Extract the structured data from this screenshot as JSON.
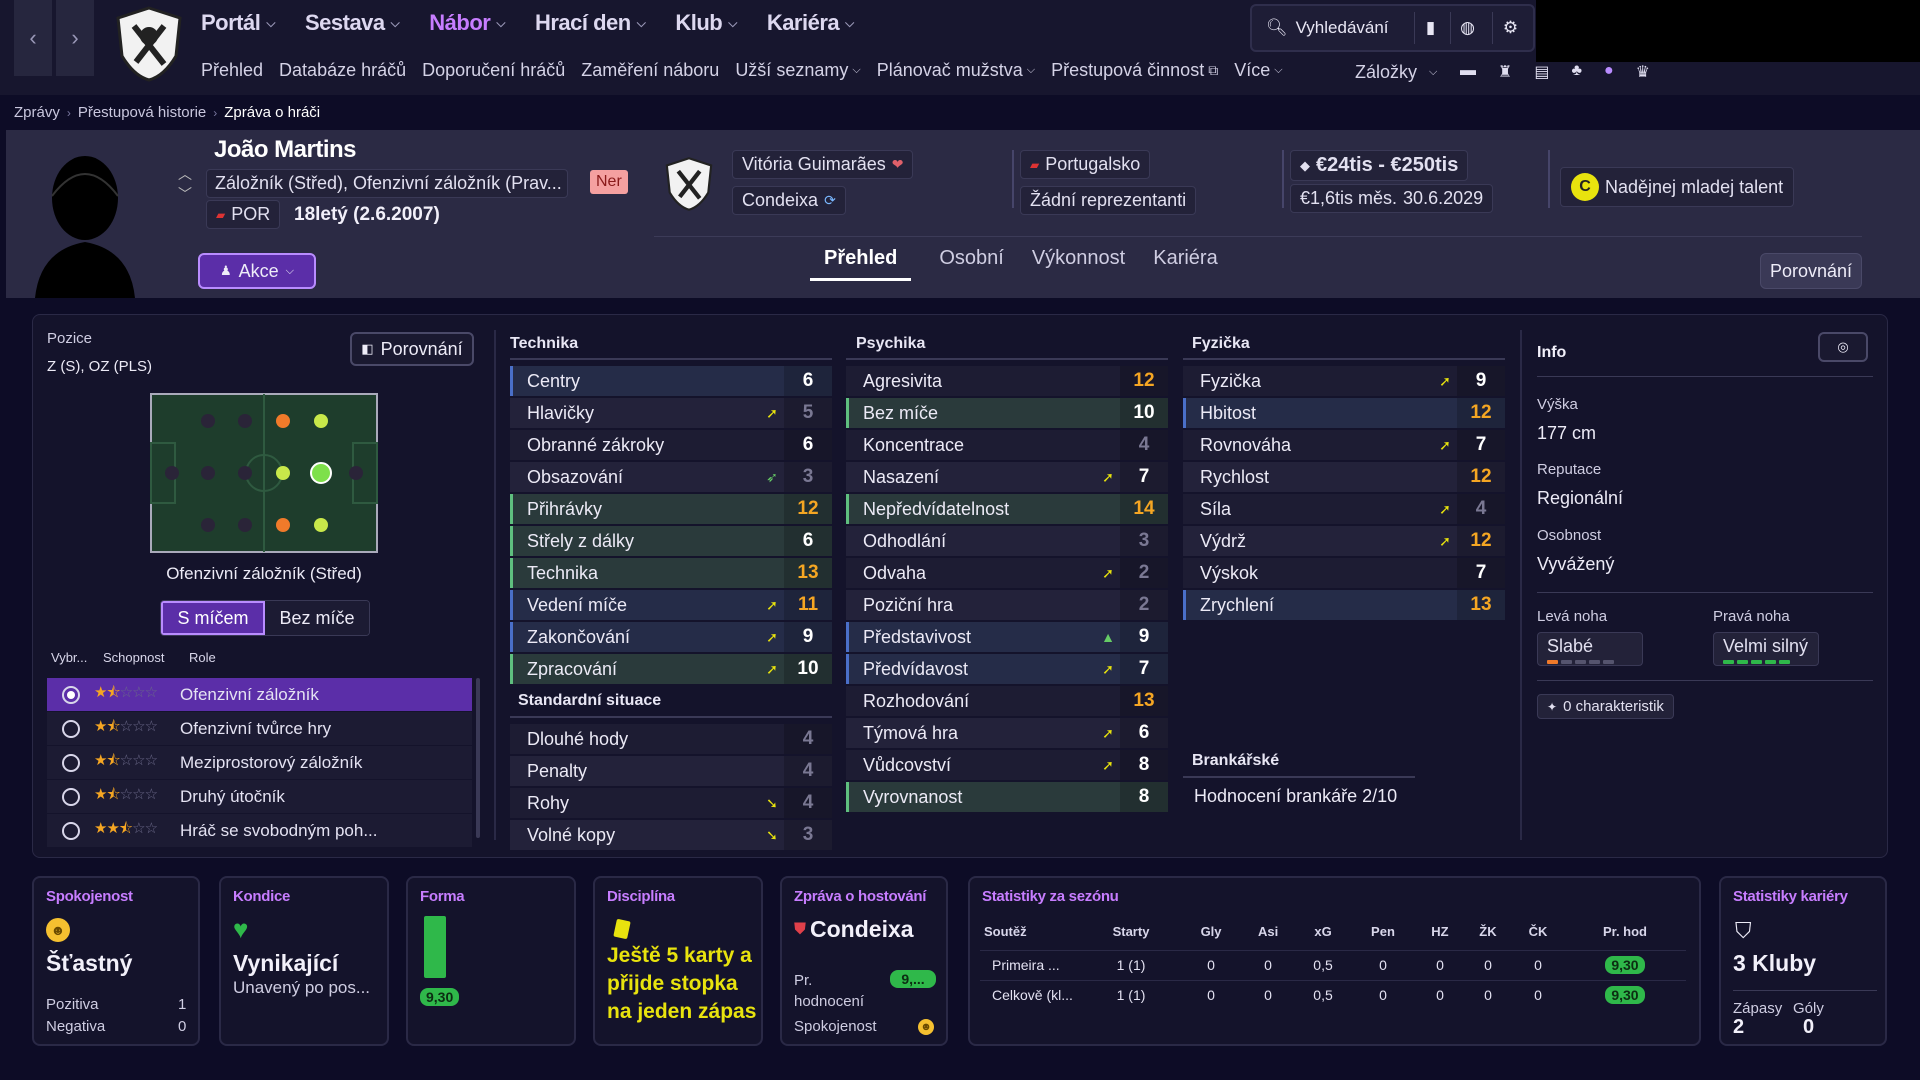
{
  "nav": {
    "main_menu": [
      "Portál",
      "Sestava",
      "Nábor",
      "Hrací den",
      "Klub",
      "Kariéra"
    ],
    "active_menu": "Nábor",
    "sub_menu": [
      "Přehled",
      "Databáze hráčů",
      "Doporučení hráčů",
      "Zaměření náboru",
      "Užší seznamy",
      "Plánovač mužstva",
      "Přestupová činnost",
      "Více"
    ],
    "search_label": "Vyhledávání",
    "bookmarks_label": "Záložky",
    "back_icon": "‹",
    "forward_icon": "›"
  },
  "breadcrumb": [
    "Zprávy",
    "Přestupová historie",
    "Zpráva o hráči"
  ],
  "player": {
    "name": "João Martins",
    "positions": "Záložník (Střed), Ofenzivní záložník (Prav...",
    "nat_code": "POR",
    "age": "18letý (2.6.2007)",
    "badge": "Ner",
    "action_label": "Akce",
    "club": "Vitória Guimarães",
    "loan_club": "Condeixa",
    "nation": "Portugalsko",
    "internationals": "Žádní reprezentanti",
    "value": "€24tis - €250tis",
    "wage": "€1,6tis měs.",
    "contract": "30.6.2029",
    "talent_letter": "C",
    "talent": "Nadějnej mladej talent",
    "compare_label": "Porovnání"
  },
  "tabs": [
    "Přehled",
    "Osobní",
    "Výkonnost",
    "Kariéra"
  ],
  "active_tab": "Přehled",
  "position_panel": {
    "title": "Pozice",
    "positions_short": "Z (S), OZ (PLS)",
    "compare_label": "Porovnání",
    "pitch_role": "Ofenzivní záložník (Střed)",
    "toggle": [
      "S míčem",
      "Bez míče"
    ],
    "role_headers": [
      "Vybr...",
      "Schopnost",
      "Role"
    ],
    "roles": [
      {
        "name": "Ofenzivní záložník",
        "stars": 1.5,
        "selected": true
      },
      {
        "name": "Ofenzivní tvůrce hry",
        "stars": 1.5,
        "selected": false
      },
      {
        "name": "Meziprostorový záložník",
        "stars": 1.5,
        "selected": false
      },
      {
        "name": "Druhý útočník",
        "stars": 1.5,
        "selected": false
      },
      {
        "name": "Hráč se svobodným poh...",
        "stars": 2.5,
        "selected": false
      }
    ]
  },
  "attributes": {
    "technika_title": "Technika",
    "technika": [
      {
        "name": "Centry",
        "value": "6",
        "arrow": "",
        "hl": "blue"
      },
      {
        "name": "Hlavičky",
        "value": "5",
        "arrow": "➚",
        "hl": ""
      },
      {
        "name": "Obranné zákroky",
        "value": "6",
        "arrow": "",
        "hl": ""
      },
      {
        "name": "Obsazování",
        "value": "3",
        "arrow": "➶",
        "hl": ""
      },
      {
        "name": "Přihrávky",
        "value": "12",
        "arrow": "",
        "hl": "green"
      },
      {
        "name": "Střely z dálky",
        "value": "6",
        "arrow": "",
        "hl": "green"
      },
      {
        "name": "Technika",
        "value": "13",
        "arrow": "",
        "hl": "green"
      },
      {
        "name": "Vedení míče",
        "value": "11",
        "arrow": "➚",
        "hl": "blue"
      },
      {
        "name": "Zakončování",
        "value": "9",
        "arrow": "➚",
        "hl": "blue"
      },
      {
        "name": "Zpracování",
        "value": "10",
        "arrow": "➚",
        "hl": "green"
      }
    ],
    "standard_title": "Standardní situace",
    "standard": [
      {
        "name": "Dlouhé hody",
        "value": "4",
        "arrow": "",
        "hl": ""
      },
      {
        "name": "Penalty",
        "value": "4",
        "arrow": "",
        "hl": ""
      },
      {
        "name": "Rohy",
        "value": "4",
        "arrow": "➘",
        "hl": ""
      },
      {
        "name": "Volné kopy",
        "value": "3",
        "arrow": "➘",
        "hl": ""
      }
    ],
    "psychika_title": "Psychika",
    "psychika": [
      {
        "name": "Agresivita",
        "value": "12",
        "arrow": "",
        "hl": ""
      },
      {
        "name": "Bez míče",
        "value": "10",
        "arrow": "",
        "hl": "green"
      },
      {
        "name": "Koncentrace",
        "value": "4",
        "arrow": "",
        "hl": ""
      },
      {
        "name": "Nasazení",
        "value": "7",
        "arrow": "➚",
        "hl": ""
      },
      {
        "name": "Nepředvídatelnost",
        "value": "14",
        "arrow": "",
        "hl": "green"
      },
      {
        "name": "Odhodlání",
        "value": "3",
        "arrow": "",
        "hl": ""
      },
      {
        "name": "Odvaha",
        "value": "2",
        "arrow": "➚",
        "hl": ""
      },
      {
        "name": "Poziční hra",
        "value": "2",
        "arrow": "",
        "hl": ""
      },
      {
        "name": "Představivost",
        "value": "9",
        "arrow": "▲",
        "hl": "blue"
      },
      {
        "name": "Předvídavost",
        "value": "7",
        "arrow": "➚",
        "hl": "blue"
      },
      {
        "name": "Rozhodování",
        "value": "13",
        "arrow": "",
        "hl": ""
      },
      {
        "name": "Týmová hra",
        "value": "6",
        "arrow": "➚",
        "hl": ""
      },
      {
        "name": "Vůdcovství",
        "value": "8",
        "arrow": "➚",
        "hl": ""
      },
      {
        "name": "Vyrovnanost",
        "value": "8",
        "arrow": "",
        "hl": "green"
      }
    ],
    "fyzicka_title": "Fyzička",
    "fyzicka": [
      {
        "name": "Fyzička",
        "value": "9",
        "arrow": "➚",
        "hl": ""
      },
      {
        "name": "Hbitost",
        "value": "12",
        "arrow": "",
        "hl": "blue"
      },
      {
        "name": "Rovnováha",
        "value": "7",
        "arrow": "➚",
        "hl": ""
      },
      {
        "name": "Rychlost",
        "value": "12",
        "arrow": "",
        "hl": ""
      },
      {
        "name": "Síla",
        "value": "4",
        "arrow": "➚",
        "hl": ""
      },
      {
        "name": "Výdrž",
        "value": "12",
        "arrow": "➚",
        "hl": ""
      },
      {
        "name": "Výskok",
        "value": "7",
        "arrow": "",
        "hl": ""
      },
      {
        "name": "Zrychlení",
        "value": "13",
        "arrow": "",
        "hl": "blue"
      }
    ],
    "gk_title": "Brankářské",
    "gk_rating": "Hodnocení brankáře 2/10"
  },
  "info": {
    "title": "Info",
    "height_label": "Výška",
    "height": "177 cm",
    "reputation_label": "Reputace",
    "reputation": "Regionální",
    "personality_label": "Osobnost",
    "personality": "Vyvážený",
    "left_foot_label": "Levá noha",
    "left_foot": "Slabé",
    "right_foot_label": "Pravá noha",
    "right_foot": "Velmi silný",
    "left_foot_level": 0.2,
    "right_foot_level": 1.0,
    "traits": "0 charakteristik"
  },
  "cards": {
    "happiness": {
      "title": "Spokojenost",
      "value": "Šťastný",
      "pos_label": "Pozitiva",
      "pos": "1",
      "neg_label": "Negativa",
      "neg": "0"
    },
    "condition": {
      "title": "Kondice",
      "value": "Vynikající",
      "sub": "Unavený po pos..."
    },
    "form": {
      "title": "Forma",
      "rating": "9,30"
    },
    "discipline": {
      "title": "Disciplína",
      "text": "Ještě 5 karty a přijde stopka na jeden zápas"
    },
    "loan": {
      "title": "Zpráva o hostování",
      "club": "Condeixa",
      "rating_label": "Pr. hodnocení",
      "rating": "9,...",
      "happiness_label": "Spokojenost"
    },
    "season": {
      "title": "Statistiky za sezónu",
      "headers": [
        "Soutěž",
        "Starty",
        "Gly",
        "Asi",
        "xG",
        "Pen",
        "HZ",
        "ŽK",
        "ČK",
        "Pr. hod"
      ],
      "rows": [
        [
          "Primeira ...",
          "1 (1)",
          "0",
          "0",
          "0,5",
          "0",
          "0",
          "0",
          "0",
          "9,30"
        ],
        [
          "Celkově (kl...",
          "1 (1)",
          "0",
          "0",
          "0,5",
          "0",
          "0",
          "0",
          "0",
          "9,30"
        ]
      ]
    },
    "career": {
      "title": "Statistiky kariéry",
      "value": "3 Kluby",
      "apps_label": "Zápasy",
      "goals_label": "Góly",
      "apps": "2",
      "goals": "0"
    }
  },
  "colors": {
    "accent": "#c77dff",
    "active_purple": "#5b2ea8",
    "green": "#2fb84a",
    "orange": "#f5a623"
  }
}
